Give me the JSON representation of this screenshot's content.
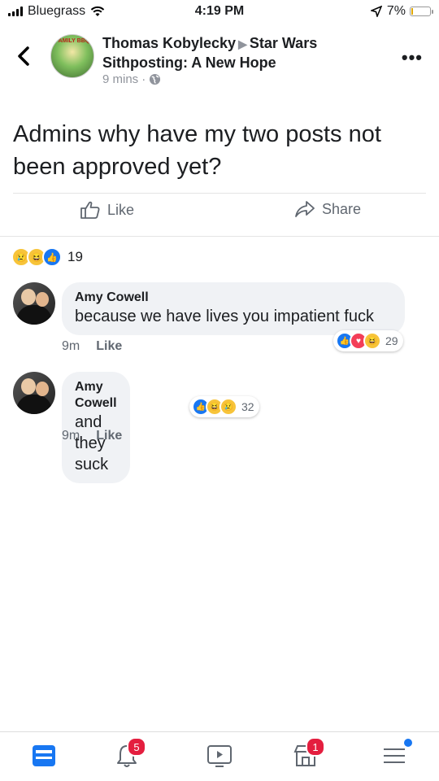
{
  "status_bar": {
    "carrier": "Bluegrass",
    "time": "4:19 PM",
    "battery": "7%"
  },
  "header": {
    "author": "Thomas Kobylecky",
    "group": "Star Wars Sithposting: A New Hope",
    "time": "9 mins",
    "avatar_caption": "FAMILY BBQ"
  },
  "post": {
    "text": "Admins why have my two posts not been approved yet?",
    "like_label": "Like",
    "share_label": "Share",
    "reaction_count": "19"
  },
  "comments": [
    {
      "author": "Amy Cowell",
      "text": "because we have lives you impatient fuck",
      "time": "9m",
      "like_label": "Like",
      "reaction_count": "29"
    },
    {
      "author": "Amy Cowell",
      "text": "and they suck",
      "time": "9m",
      "like_label": "Like",
      "reaction_count": "32"
    }
  ],
  "bottom_nav": {
    "notifications_badge": "5",
    "marketplace_badge": "1"
  },
  "colors": {
    "accent": "#1877f2",
    "badge": "#e41e3f",
    "text": "#1c1e21",
    "muted": "#606770"
  }
}
